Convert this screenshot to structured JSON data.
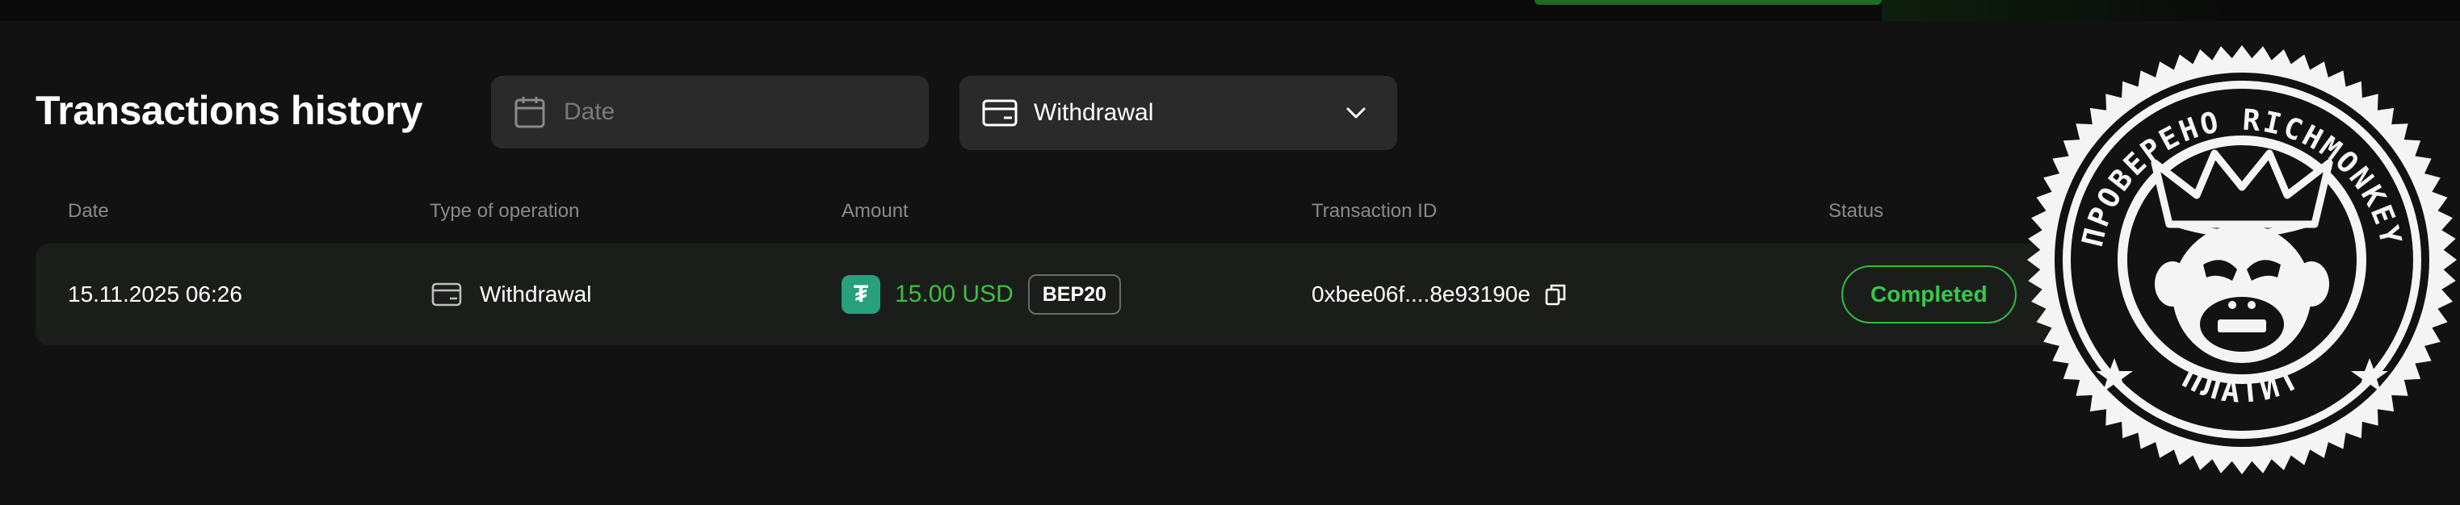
{
  "header": {
    "title": "Transactions history"
  },
  "filters": {
    "date": {
      "placeholder": "Date",
      "icon": "calendar-icon"
    },
    "operation_type": {
      "selected": "Withdrawal",
      "icon": "card-icon"
    }
  },
  "table": {
    "columns": [
      "Date",
      "Type of operation",
      "Amount",
      "Transaction ID",
      "Status"
    ],
    "rows": [
      {
        "date": "15.11.2025 06:26",
        "type": "Withdrawal",
        "amount": "15.00 USD",
        "currency_icon": "tether-icon",
        "network": "BEP20",
        "transaction_id": "0xbee06f....8e93190e",
        "status": "Completed"
      }
    ]
  },
  "stamp": {
    "top_text": "ПРОВЕРЕНО RICHMONKEY",
    "bottom_text": "ПЛАТИТ"
  },
  "colors": {
    "background": "#121212",
    "accent_green": "#37c94a",
    "tether": "#26a17b"
  }
}
